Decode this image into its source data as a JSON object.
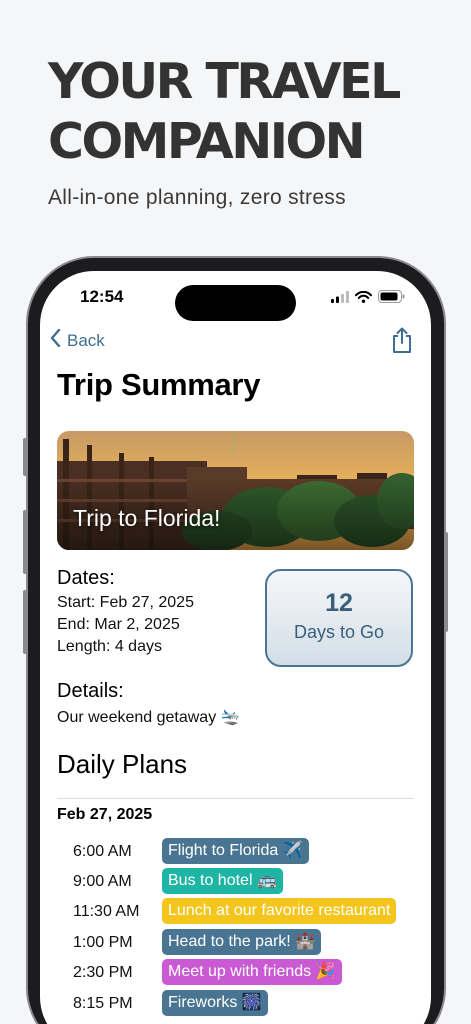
{
  "promo": {
    "headline_line1": "YOUR TRAVEL",
    "headline_line2": "COMPANION",
    "tagline": "All-in-one planning, zero stress"
  },
  "status_bar": {
    "time": "12:54"
  },
  "nav": {
    "back_label": "Back"
  },
  "page": {
    "title": "Trip Summary"
  },
  "trip": {
    "name": "Trip to Florida!",
    "dates_heading": "Dates:",
    "start": "Start: Feb 27, 2025",
    "end": "End: Mar 2, 2025",
    "length": "Length: 4 days",
    "details_heading": "Details:",
    "details": "Our weekend getaway 🛬"
  },
  "countdown": {
    "number": "12",
    "label": "Days to Go"
  },
  "daily_plans": {
    "heading": "Daily Plans",
    "day": "Feb 27, 2025",
    "items": [
      {
        "time": "6:00 AM",
        "label": "Flight to Florida ✈️",
        "color": "#4a7592"
      },
      {
        "time": "9:00 AM",
        "label": "Bus to hotel 🚌",
        "color": "#1fb5a5"
      },
      {
        "time": "11:30 AM",
        "label": "Lunch at our favorite restaurant",
        "color": "#f4c51c"
      },
      {
        "time": "1:00 PM",
        "label": "Head to the park! 🏰",
        "color": "#4a7592"
      },
      {
        "time": "2:30 PM",
        "label": "Meet up with friends 🎉",
        "color": "#c95ad4"
      },
      {
        "time": "8:15 PM",
        "label": "Fireworks 🎆",
        "color": "#4a7592"
      }
    ]
  },
  "colors": {
    "accent": "#3f6e8f",
    "background": "#f5f6f8"
  }
}
